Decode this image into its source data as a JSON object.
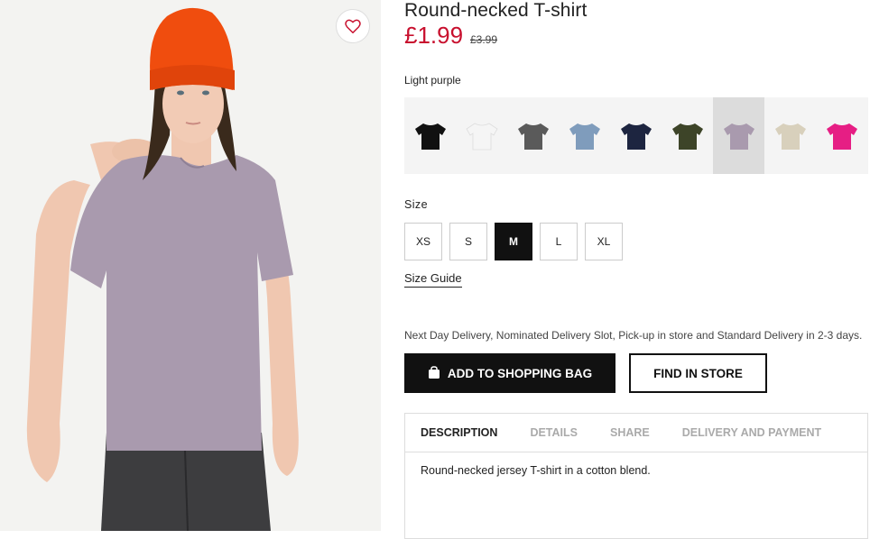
{
  "product": {
    "title": "Round-necked T-shirt",
    "price": "£1.99",
    "old_price": "£3.99",
    "selected_color": "Light purple",
    "size_label": "Size",
    "size_guide": "Size Guide",
    "delivery_note": "Next Day Delivery, Nominated Delivery Slot, Pick-up in store and Standard Delivery in 2-3 days.",
    "add_to_bag": "ADD TO SHOPPING BAG",
    "find_in_store": "FIND IN STORE",
    "description": "Round-necked jersey T-shirt in a cotton blend."
  },
  "colors": {
    "price": "#c8102e",
    "swatches": [
      "#111111",
      "#f5f5f5",
      "#5a5a5a",
      "#7f9cbc",
      "#1d2540",
      "#3d4428",
      "#a99aae",
      "#d8d0bc",
      "#e61e84"
    ]
  },
  "sizes": [
    {
      "label": "XS",
      "selected": false
    },
    {
      "label": "S",
      "selected": false
    },
    {
      "label": "M",
      "selected": true
    },
    {
      "label": "L",
      "selected": false
    },
    {
      "label": "XL",
      "selected": false
    }
  ],
  "tabs": [
    {
      "label": "DESCRIPTION",
      "active": true
    },
    {
      "label": "DETAILS",
      "active": false
    },
    {
      "label": "SHARE",
      "active": false
    },
    {
      "label": "DELIVERY AND PAYMENT",
      "active": false
    }
  ],
  "icons": {
    "wishlist": "heart-icon",
    "bag": "shopping-bag-icon"
  }
}
